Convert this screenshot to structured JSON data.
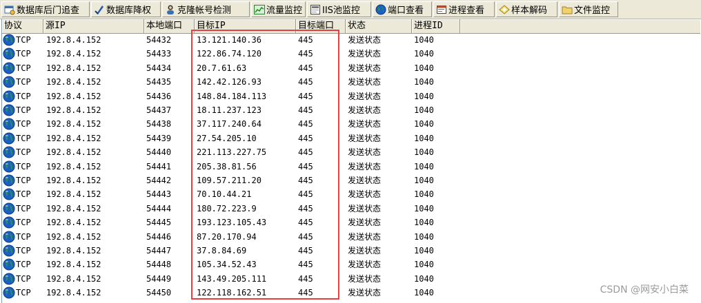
{
  "toolbar": {
    "buttons": [
      {
        "label": "数据库后门追查",
        "icon": "db-backdoor-icon"
      },
      {
        "label": "数据库降权",
        "icon": "db-downgrade-icon"
      },
      {
        "label": "克隆帐号检测",
        "icon": "clone-account-icon"
      },
      {
        "label": "流量监控",
        "icon": "traffic-chart-icon"
      },
      {
        "label": "IIS池监控",
        "icon": "iis-pool-icon"
      },
      {
        "label": "端口查看",
        "icon": "globe-icon"
      },
      {
        "label": "进程查看",
        "icon": "process-window-icon"
      },
      {
        "label": "样本解码",
        "icon": "sample-decode-icon"
      },
      {
        "label": "文件监控",
        "icon": "folder-icon"
      }
    ]
  },
  "table": {
    "headers": [
      "协议",
      "源IP",
      "本地端口",
      "目标IP",
      "目标端口",
      "状态",
      "进程ID"
    ],
    "rows": [
      [
        "TCP",
        "192.8.4.152",
        "54432",
        "13.121.140.36",
        "445",
        "发送状态",
        "1040"
      ],
      [
        "TCP",
        "192.8.4.152",
        "54433",
        "122.86.74.120",
        "445",
        "发送状态",
        "1040"
      ],
      [
        "TCP",
        "192.8.4.152",
        "54434",
        "20.7.61.63",
        "445",
        "发送状态",
        "1040"
      ],
      [
        "TCP",
        "192.8.4.152",
        "54435",
        "142.42.126.93",
        "445",
        "发送状态",
        "1040"
      ],
      [
        "TCP",
        "192.8.4.152",
        "54436",
        "148.84.184.113",
        "445",
        "发送状态",
        "1040"
      ],
      [
        "TCP",
        "192.8.4.152",
        "54437",
        "18.11.237.123",
        "445",
        "发送状态",
        "1040"
      ],
      [
        "TCP",
        "192.8.4.152",
        "54438",
        "37.117.240.64",
        "445",
        "发送状态",
        "1040"
      ],
      [
        "TCP",
        "192.8.4.152",
        "54439",
        "27.54.205.10",
        "445",
        "发送状态",
        "1040"
      ],
      [
        "TCP",
        "192.8.4.152",
        "54440",
        "221.113.227.75",
        "445",
        "发送状态",
        "1040"
      ],
      [
        "TCP",
        "192.8.4.152",
        "54441",
        "205.38.81.56",
        "445",
        "发送状态",
        "1040"
      ],
      [
        "TCP",
        "192.8.4.152",
        "54442",
        "109.57.211.20",
        "445",
        "发送状态",
        "1040"
      ],
      [
        "TCP",
        "192.8.4.152",
        "54443",
        "70.10.44.21",
        "445",
        "发送状态",
        "1040"
      ],
      [
        "TCP",
        "192.8.4.152",
        "54444",
        "180.72.223.9",
        "445",
        "发送状态",
        "1040"
      ],
      [
        "TCP",
        "192.8.4.152",
        "54445",
        "193.123.105.43",
        "445",
        "发送状态",
        "1040"
      ],
      [
        "TCP",
        "192.8.4.152",
        "54446",
        "87.20.170.94",
        "445",
        "发送状态",
        "1040"
      ],
      [
        "TCP",
        "192.8.4.152",
        "54447",
        "37.8.84.69",
        "445",
        "发送状态",
        "1040"
      ],
      [
        "TCP",
        "192.8.4.152",
        "54448",
        "105.34.52.43",
        "445",
        "发送状态",
        "1040"
      ],
      [
        "TCP",
        "192.8.4.152",
        "54449",
        "143.49.205.111",
        "445",
        "发送状态",
        "1040"
      ],
      [
        "TCP",
        "192.8.4.152",
        "54450",
        "122.118.162.51",
        "445",
        "发送状态",
        "1040"
      ]
    ]
  },
  "watermark": "CSDN @网安小白菜",
  "colors": {
    "toolbar_bg": "#ece9d8",
    "highlight_border": "#e34141",
    "globe_blue": "#1a5fc4",
    "globe_green": "#2e9b2e"
  }
}
